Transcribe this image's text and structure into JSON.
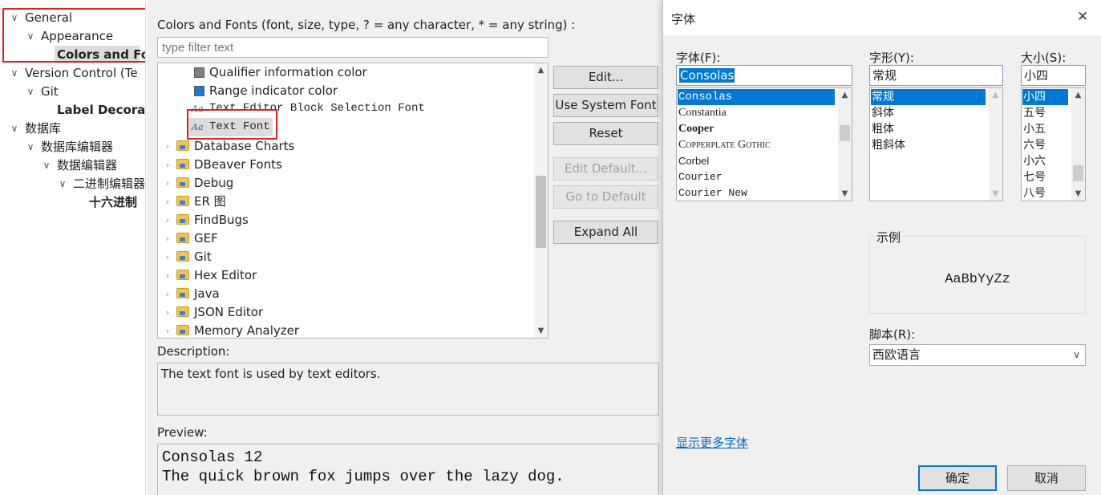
{
  "left_tree": {
    "items": [
      {
        "label": "General",
        "expanded": true
      },
      {
        "label": "Appearance",
        "expanded": true
      },
      {
        "label": "Colors and Fo",
        "selected": true
      },
      {
        "label": "Version Control (Te",
        "expanded": true
      },
      {
        "label": "Git",
        "expanded": true
      },
      {
        "label": "Label Decorat"
      },
      {
        "label": "数据库",
        "expanded": true
      },
      {
        "label": "数据库编辑器",
        "expanded": true
      },
      {
        "label": "数据编辑器",
        "expanded": true
      },
      {
        "label": "二进制编辑器",
        "expanded": true
      },
      {
        "label": "十六进制"
      }
    ]
  },
  "center": {
    "heading": "Colors and Fonts (font, size, type, ? = any character, * = any string) :",
    "filter_placeholder": "type filter text",
    "tree_rows": [
      {
        "label": "Qualifier information color",
        "kind": "color",
        "color": "#808080"
      },
      {
        "label": "Range indicator color",
        "kind": "color",
        "color": "#1e78d7"
      },
      {
        "label": "Text Editor Block Selection Font",
        "kind": "font"
      },
      {
        "label": "Text Font",
        "kind": "font",
        "selected": true
      },
      {
        "label": "Database Charts",
        "kind": "folder"
      },
      {
        "label": "DBeaver Fonts",
        "kind": "folder"
      },
      {
        "label": "Debug",
        "kind": "folder"
      },
      {
        "label": "ER 图",
        "kind": "folder"
      },
      {
        "label": "FindBugs",
        "kind": "folder"
      },
      {
        "label": "GEF",
        "kind": "folder"
      },
      {
        "label": "Git",
        "kind": "folder"
      },
      {
        "label": "Hex Editor",
        "kind": "folder"
      },
      {
        "label": "Java",
        "kind": "folder"
      },
      {
        "label": "JSON Editor",
        "kind": "folder"
      },
      {
        "label": "Memory Analyzer",
        "kind": "folder"
      }
    ],
    "font_icon_glyph": "Aa",
    "buttons": {
      "edit": "Edit...",
      "use_system_font": "Use System Font",
      "reset": "Reset",
      "edit_default": "Edit Default...",
      "go_to_default": "Go to Default",
      "expand_all": "Expand All"
    },
    "description_label": "Description:",
    "description_text": "The text font is used by text editors.",
    "preview_label": "Preview:",
    "preview_line1": "Consolas 12",
    "preview_line2": "The quick brown fox jumps over the lazy dog."
  },
  "dialog": {
    "title": "字体",
    "close_glyph": "✕",
    "font_label": "字体(F):",
    "font_value": "Consolas",
    "font_list": [
      "Consolas",
      "Constantia",
      "Cooper",
      "Copperplate Gothic",
      "Corbel",
      "Courier",
      "Courier New"
    ],
    "style_label": "字形(Y):",
    "style_value": "常规",
    "style_list": [
      "常规",
      "斜体",
      "粗体",
      "粗斜体"
    ],
    "size_label": "大小(S):",
    "size_value": "小四",
    "size_list": [
      "小四",
      "五号",
      "小五",
      "六号",
      "小六",
      "七号",
      "八号"
    ],
    "sample_label": "示例",
    "sample_text": "AaBbYyZz",
    "script_label": "脚本(R):",
    "script_value": "西欧语言",
    "more_fonts_link": "显示更多字体",
    "ok": "确定",
    "cancel": "取消"
  },
  "colors": {
    "selection": "#0078d7",
    "highlight_border": "#e02020",
    "link": "#0066cc"
  }
}
